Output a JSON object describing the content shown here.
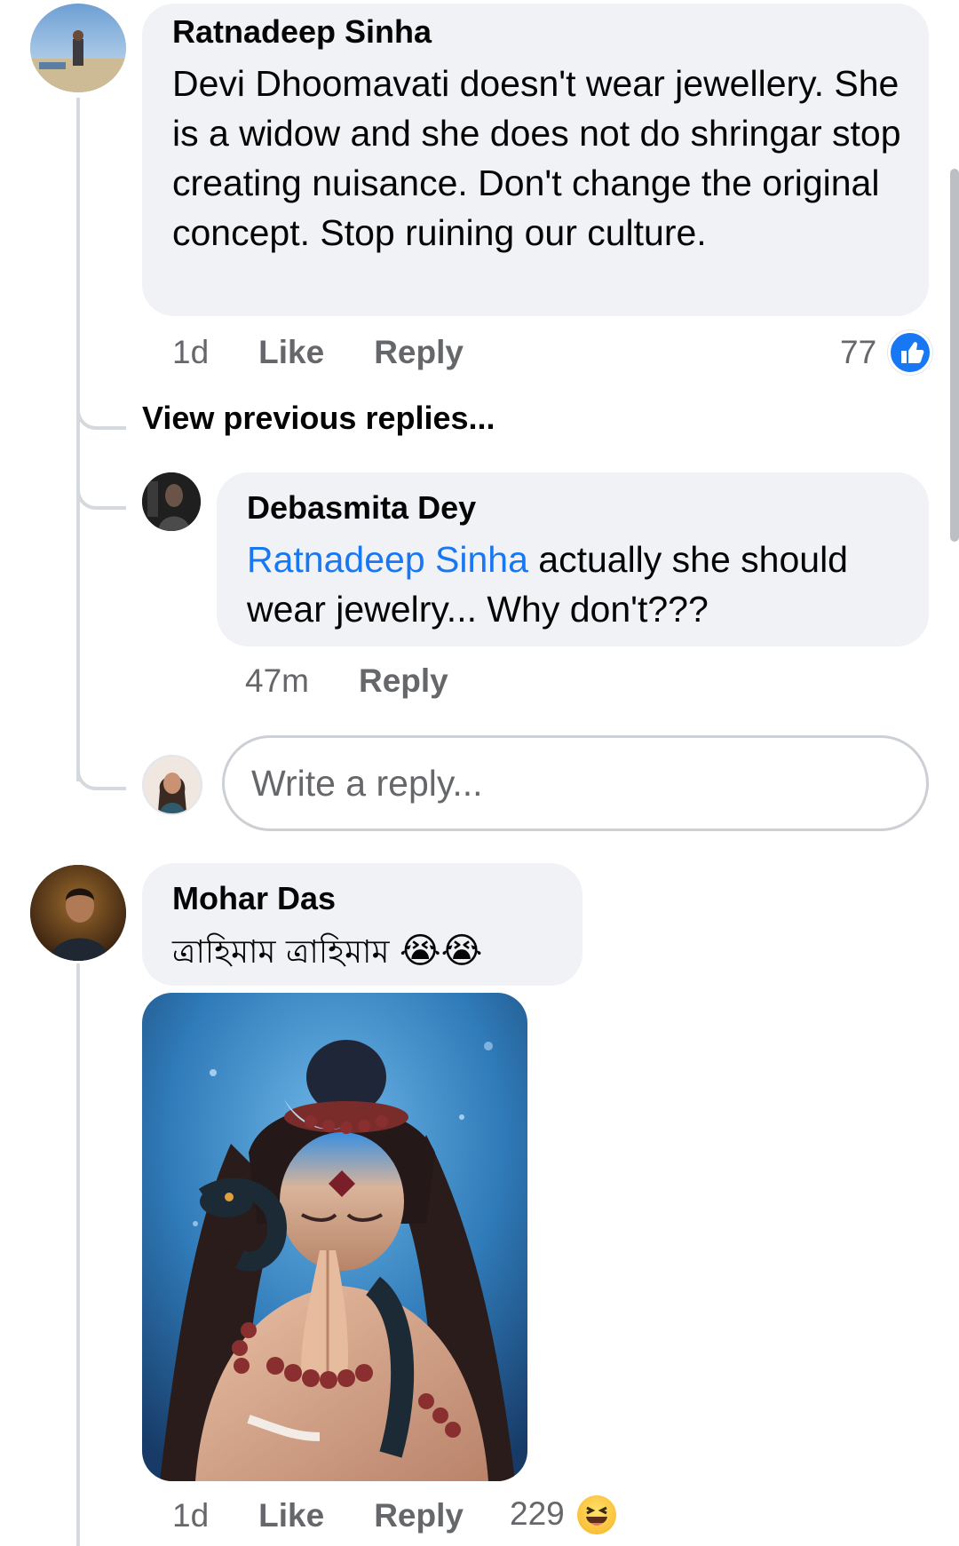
{
  "comment1": {
    "author": "Ratnadeep Sinha",
    "text": "Devi Dhoomavati doesn't wear jewellery. She is a widow and she does not do shringar stop creating nuisance. Don't change the original concept. Stop ruining our culture.",
    "time": "1d",
    "like_label": "Like",
    "reply_label": "Reply",
    "reaction_count": "77",
    "reaction_icon": "like-icon"
  },
  "view_previous": "View previous replies...",
  "reply1": {
    "author": "Debasmita Dey",
    "mention": "Ratnadeep Sinha",
    "text": " actually she should wear jewelry... Why don't???",
    "time": "47m",
    "reply_label": "Reply"
  },
  "reply_input": {
    "placeholder": "Write a reply..."
  },
  "comment2": {
    "author": "Mohar Das",
    "text": "ত্রাহিমাম ত্রাহিমাম",
    "emojis": "😭😭",
    "time": "1d",
    "like_label": "Like",
    "reply_label": "Reply",
    "reaction_count": "229",
    "reaction_icon": "haha-icon"
  },
  "colors": {
    "bubble": "#f0f2f5",
    "link": "#1877f2",
    "meta": "#65676b",
    "thread_line": "#d5d8dd"
  }
}
